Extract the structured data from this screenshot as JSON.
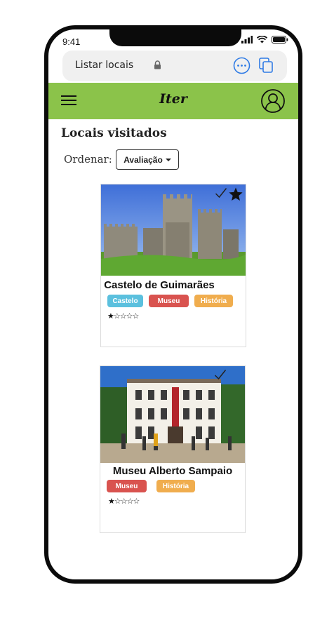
{
  "status": {
    "time": "9:41"
  },
  "browser": {
    "url_title": "Listar locais"
  },
  "app": {
    "brand": "Iter"
  },
  "page": {
    "title": "Locais visitados",
    "sort_label": "Ordenar:",
    "sort_value": "Avaliação"
  },
  "places": [
    {
      "name": "Castelo de Guimarães",
      "tags": [
        "Castelo",
        "Museu",
        "História"
      ],
      "rating": 1,
      "rating_max": 5,
      "visited": true,
      "favorite": true,
      "rating_text": "★☆☆☆☆"
    },
    {
      "name": "Museu Alberto Sampaio",
      "tags": [
        "Museu",
        "História"
      ],
      "rating": 1,
      "rating_max": 5,
      "visited": true,
      "favorite": false,
      "rating_text": "★☆☆☆☆"
    }
  ],
  "colors": {
    "appbar": "#8bc34a",
    "tag_castelo": "#5bc0de",
    "tag_museu": "#d9534f",
    "tag_historia": "#f0ad4e"
  },
  "icons": [
    "signal-icon",
    "wifi-icon",
    "battery-icon",
    "lock-icon",
    "more-options-icon",
    "tabs-icon",
    "menu-icon",
    "profile-icon",
    "visited-check-icon",
    "favorite-star-icon",
    "rating-star-icon"
  ]
}
